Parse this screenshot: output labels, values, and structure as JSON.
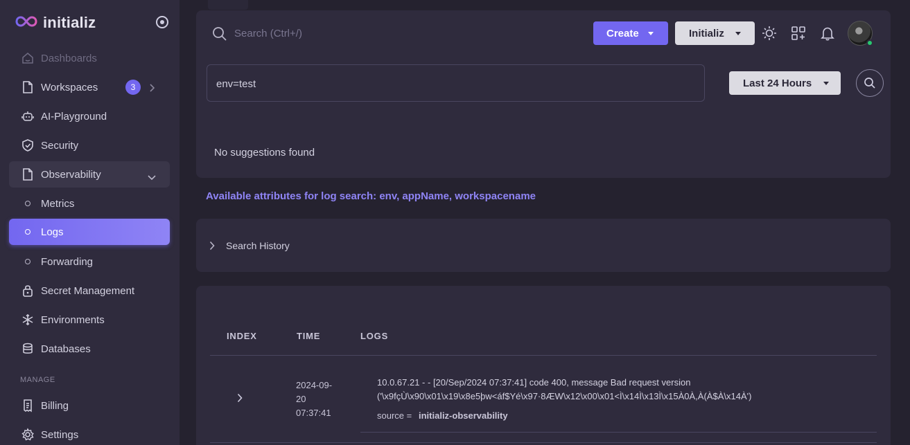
{
  "brand": {
    "name": "initializ",
    "logo_icon": "infinity-logo-icon",
    "accent": "#7367f0"
  },
  "sidebar": {
    "items": [
      {
        "label": "Dashboards",
        "icon": "smart-home-icon",
        "state": "muted"
      },
      {
        "label": "Workspaces",
        "icon": "file-icon",
        "badge": "3"
      },
      {
        "label": "AI-Playground",
        "icon": "robot-icon"
      },
      {
        "label": "Security",
        "icon": "shield-check-icon"
      },
      {
        "label": "Observability",
        "icon": "file-icon",
        "state": "open"
      },
      {
        "label": "Metrics",
        "icon": "circle-icon"
      },
      {
        "label": "Logs",
        "icon": "circle-icon",
        "state": "active"
      },
      {
        "label": "Forwarding",
        "icon": "circle-icon"
      },
      {
        "label": "Secret Management",
        "icon": "lock-icon"
      },
      {
        "label": "Environments",
        "icon": "snowflake-icon"
      },
      {
        "label": "Databases",
        "icon": "database-icon"
      }
    ],
    "section_manage": "MANAGE",
    "manage_items": [
      {
        "label": "Billing",
        "icon": "receipt-icon"
      },
      {
        "label": "Settings",
        "icon": "gear-icon"
      }
    ]
  },
  "header": {
    "search_placeholder": "Search (Ctrl+/)",
    "create_label": "Create",
    "org_label": "Initializ",
    "icons": [
      "sun-icon",
      "apps-add-icon",
      "bell-icon"
    ],
    "avatar_status_color": "#28c76f"
  },
  "query": {
    "value": "env=test",
    "time_range": "Last 24 Hours",
    "no_suggestions": "No suggestions found"
  },
  "attributes_text": "Available attributes for log search: env, appName, workspacename",
  "history": {
    "label": "Search History"
  },
  "table": {
    "columns": [
      "INDEX",
      "TIME",
      "LOGS"
    ],
    "rows": [
      {
        "time_lines": [
          "2024-09-",
          "20",
          "07:37:41"
        ],
        "log_line_1": "10.0.67.21 - - [20/Sep/2024 07:37:41] code 400, message Bad request version",
        "log_line_2": "('\\x9fçÙ\\x90\\x01\\x19\\x8e5þw<áf$Yé\\x97·8ÆW\\x12\\x00\\x01<Ì\\x14Ì\\x13Ì\\x15À0À,À(À$À\\x14À')",
        "source_label": "source =",
        "source_value": "initializ-observability"
      }
    ]
  }
}
